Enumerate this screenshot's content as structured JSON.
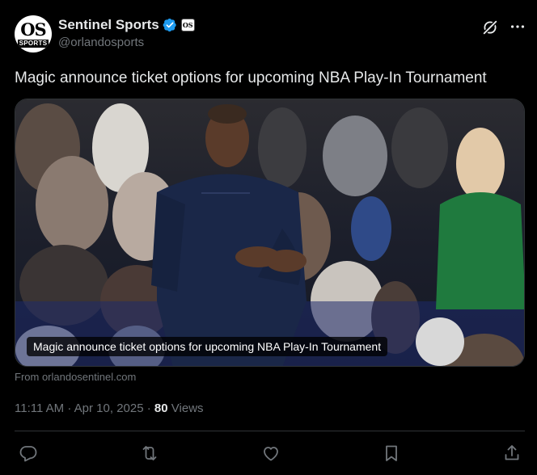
{
  "account": {
    "display_name": "Sentinel Sports",
    "handle": "@orlandosports",
    "avatar_text": "OS",
    "avatar_subtext": "SPORTS",
    "affiliate_badge": "OS",
    "verified_color": "#1d9bf0"
  },
  "tweet": {
    "text": "Magic announce ticket options for upcoming NBA Play-In Tournament"
  },
  "card": {
    "title": "Magic announce ticket options for upcoming NBA Play-In Tournament",
    "source": "From orlandosentinel.com",
    "image_alt": "Orlando Magic coach clapping courtside with fans in the stands"
  },
  "meta": {
    "time": "11:11 AM",
    "date": "Apr 10, 2025",
    "views_count": "80",
    "views_label": "Views",
    "separator": "·"
  },
  "icons": {
    "grok": "grok-icon",
    "more": "more-icon",
    "reply": "reply-icon",
    "retweet": "retweet-icon",
    "like": "heart-icon",
    "bookmark": "bookmark-icon",
    "share": "share-icon"
  },
  "colors": {
    "background": "#000000",
    "text_primary": "#e7e9ea",
    "text_secondary": "#71767b",
    "border": "#2f3336"
  }
}
